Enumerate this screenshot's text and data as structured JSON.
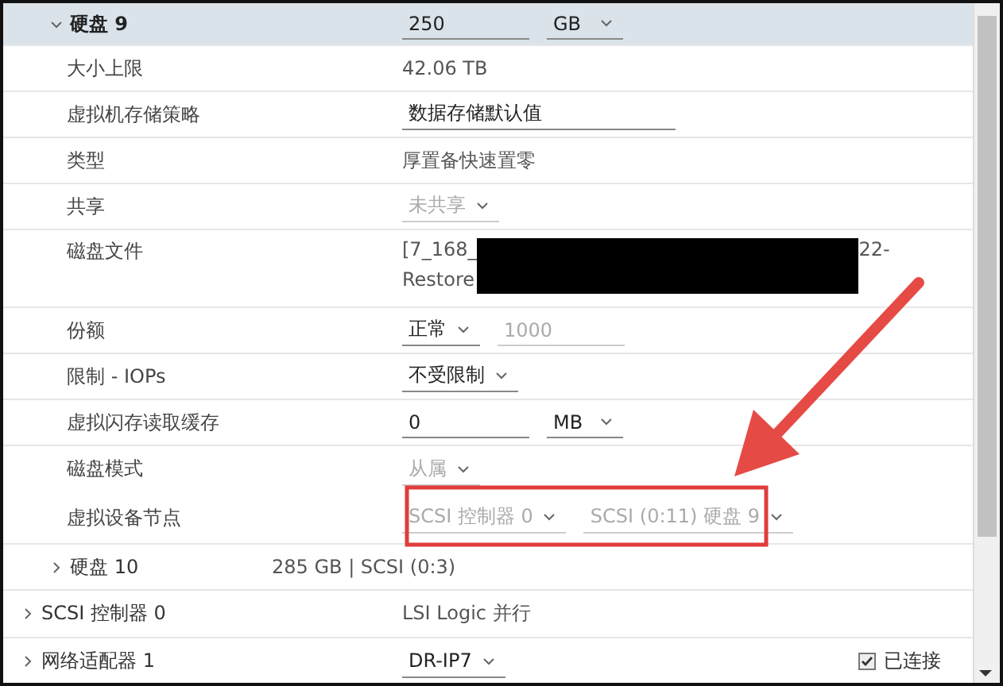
{
  "disks": [
    {
      "title": "硬盘 9",
      "expanded": true,
      "controls": [
        {
          "kind": "field",
          "value": "250",
          "disabled": false
        },
        {
          "kind": "select",
          "value": "GB",
          "disabled": false
        }
      ],
      "rows": [
        {
          "kind": "text",
          "label": "大小上限",
          "value": "42.06 TB"
        },
        {
          "kind": "controls",
          "label": "虚拟机存储策略",
          "controls": [
            {
              "kind": "wide_field",
              "value": "数据存储默认值",
              "disabled": false
            }
          ]
        },
        {
          "kind": "text",
          "label": "类型",
          "value": "厚置备快速置零"
        },
        {
          "kind": "controls",
          "label": "共享",
          "controls": [
            {
              "kind": "select",
              "value": "未共享",
              "disabled": true
            }
          ]
        },
        {
          "kind": "file",
          "label": "磁盘文件",
          "value_start": "[7_168_",
          "value_end": "22-",
          "line_2": "Restore"
        },
        {
          "kind": "controls",
          "label": "份额",
          "controls": [
            {
              "kind": "select",
              "value": "正常",
              "disabled": false
            },
            {
              "kind": "field",
              "value": "1000",
              "disabled": true
            }
          ]
        },
        {
          "kind": "controls",
          "label": "限制 - IOPs",
          "controls": [
            {
              "kind": "select",
              "value": "不受限制",
              "disabled": false
            }
          ]
        },
        {
          "kind": "controls",
          "label": "虚拟闪存读取缓存",
          "controls": [
            {
              "kind": "field",
              "value": "0",
              "disabled": false
            },
            {
              "kind": "select",
              "value": "MB",
              "disabled": false
            }
          ]
        },
        {
          "kind": "controls",
          "label": "磁盘模式",
          "controls": [
            {
              "kind": "select",
              "value": "从属",
              "disabled": true
            }
          ]
        },
        {
          "kind": "controls",
          "label": "虚拟设备节点",
          "controls": [
            {
              "kind": "select",
              "value": "SCSI 控制器 0",
              "disabled": true
            },
            {
              "kind": "select",
              "value": "SCSI (0:11) 硬盘 9",
              "disabled": true
            }
          ]
        }
      ]
    },
    {
      "title": "硬盘 10",
      "expanded": false,
      "value": "285 GB | SCSI (0:3)"
    }
  ],
  "devices": [
    {
      "title": "SCSI 控制器 0",
      "expanded": false,
      "value": "LSI Logic 并行"
    },
    {
      "title": "网络适配器 1",
      "expanded": false,
      "select": "DR-IP7",
      "checkbox": {
        "label": "已连接",
        "checked": true
      }
    }
  ]
}
